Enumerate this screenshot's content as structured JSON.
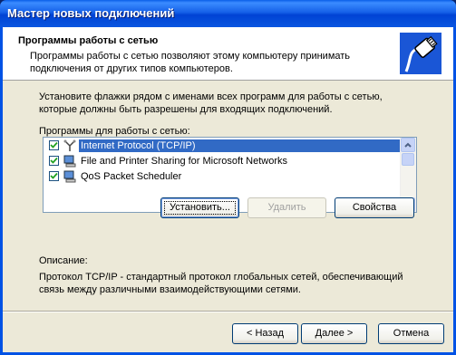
{
  "window": {
    "title": "Мастер новых подключений"
  },
  "header": {
    "title": "Программы работы с сетью",
    "description": "Программы работы с сетью позволяют этому компьютеру принимать подключения от других типов компьютеров."
  },
  "instructions": "Установите флажки рядом с именами всех программ для работы с сетью, которые должны быть разрешены для входящих подключений.",
  "list": {
    "label": "Программы для работы с сетью:",
    "items": [
      {
        "label": "Internet Protocol (TCP/IP)",
        "checked": true,
        "selected": true,
        "icon": "network-protocol-icon"
      },
      {
        "label": "File and Printer Sharing for Microsoft Networks",
        "checked": true,
        "selected": false,
        "icon": "network-service-icon"
      },
      {
        "label": "QoS Packet Scheduler",
        "checked": true,
        "selected": false,
        "icon": "network-service-icon"
      }
    ]
  },
  "buttons": {
    "install": "Установить...",
    "remove": "Удалить",
    "properties": "Свойства",
    "back": "< Назад",
    "next": "Далее >",
    "cancel": "Отмена"
  },
  "description": {
    "label": "Описание:",
    "text": "Протокол TCP/IP - стандартный протокол глобальных сетей, обеспечивающий связь между различными взаимодействующими сетями."
  }
}
